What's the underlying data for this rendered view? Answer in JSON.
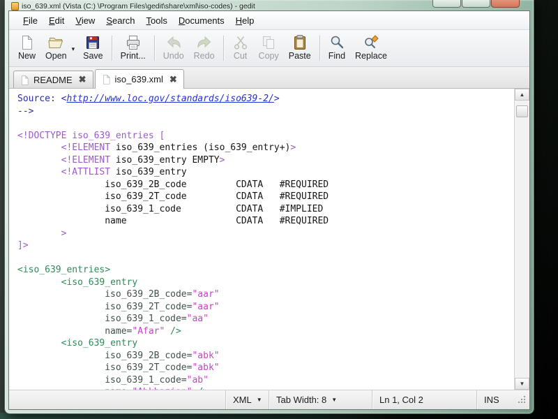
{
  "window": {
    "title": "iso_639.xml (Vista (C:) \\Program Files\\gedit\\share\\xml\\iso-codes) - gedit",
    "controls": [
      "minimize",
      "maximize",
      "close"
    ]
  },
  "menu_bar": {
    "items": [
      {
        "label": "File"
      },
      {
        "label": "Edit"
      },
      {
        "label": "View"
      },
      {
        "label": "Search"
      },
      {
        "label": "Tools"
      },
      {
        "label": "Documents"
      },
      {
        "label": "Help"
      }
    ]
  },
  "toolbar": {
    "items": [
      {
        "label": "New",
        "icon": "new-document-icon",
        "enabled": true
      },
      {
        "label": "Open",
        "icon": "open-folder-icon",
        "enabled": true,
        "caret": true
      },
      {
        "label": "Save",
        "icon": "save-icon",
        "enabled": true
      },
      {
        "type": "separator"
      },
      {
        "label": "Print...",
        "icon": "print-icon",
        "enabled": true
      },
      {
        "type": "separator"
      },
      {
        "label": "Undo",
        "icon": "undo-icon",
        "enabled": false
      },
      {
        "label": "Redo",
        "icon": "redo-icon",
        "enabled": false
      },
      {
        "type": "separator"
      },
      {
        "label": "Cut",
        "icon": "cut-icon",
        "enabled": false
      },
      {
        "label": "Copy",
        "icon": "copy-icon",
        "enabled": false
      },
      {
        "label": "Paste",
        "icon": "paste-icon",
        "enabled": true
      },
      {
        "type": "separator"
      },
      {
        "label": "Find",
        "icon": "find-icon",
        "enabled": true
      },
      {
        "label": "Replace",
        "icon": "replace-icon",
        "enabled": true
      }
    ]
  },
  "tab_bar": {
    "tabs": [
      {
        "title": "README",
        "active": false
      },
      {
        "title": "iso_639.xml",
        "active": true
      }
    ]
  },
  "editor": {
    "lines": [
      {
        "segs": [
          [
            "c",
            "Source: <"
          ],
          [
            "l",
            "http://www.loc.gov/standards/iso639-2/"
          ],
          [
            "c",
            ">"
          ]
        ]
      },
      {
        "segs": [
          [
            "c",
            "-->"
          ]
        ]
      },
      {
        "segs": []
      },
      {
        "segs": [
          [
            "k",
            "<!DOCTYPE iso_639_entries ["
          ]
        ]
      },
      {
        "segs": [
          [
            "p",
            "\t"
          ],
          [
            "k",
            "<!ELEMENT"
          ],
          [
            "p",
            " iso_639_entries (iso_639_entry+)"
          ],
          [
            "k",
            ">"
          ]
        ]
      },
      {
        "segs": [
          [
            "p",
            "\t"
          ],
          [
            "k",
            "<!ELEMENT"
          ],
          [
            "p",
            " iso_639_entry EMPTY"
          ],
          [
            "k",
            ">"
          ]
        ]
      },
      {
        "segs": [
          [
            "p",
            "\t"
          ],
          [
            "k",
            "<!ATTLIST"
          ],
          [
            "p",
            " iso_639_entry"
          ]
        ]
      },
      {
        "segs": [
          [
            "p",
            "\t\tiso_639_2B_code\t\tCDATA\t#REQUIRED"
          ]
        ]
      },
      {
        "segs": [
          [
            "p",
            "\t\tiso_639_2T_code\t\tCDATA\t#REQUIRED"
          ]
        ]
      },
      {
        "segs": [
          [
            "p",
            "\t\tiso_639_1_code\t\tCDATA\t#IMPLIED"
          ]
        ]
      },
      {
        "segs": [
          [
            "p",
            "\t\tname\t\t\tCDATA\t#REQUIRED"
          ]
        ]
      },
      {
        "segs": [
          [
            "p",
            "\t"
          ],
          [
            "k",
            ">"
          ]
        ]
      },
      {
        "segs": [
          [
            "k",
            "]>"
          ]
        ]
      },
      {
        "segs": []
      },
      {
        "segs": [
          [
            "e",
            "<iso_639_entries>"
          ]
        ]
      },
      {
        "segs": [
          [
            "p",
            "\t"
          ],
          [
            "e",
            "<iso_639_entry"
          ]
        ]
      },
      {
        "segs": [
          [
            "p",
            "\t\t"
          ],
          [
            "a",
            "iso_639_2B_code="
          ],
          [
            "v",
            "\"aar\""
          ]
        ]
      },
      {
        "segs": [
          [
            "p",
            "\t\t"
          ],
          [
            "a",
            "iso_639_2T_code="
          ],
          [
            "v",
            "\"aar\""
          ]
        ]
      },
      {
        "segs": [
          [
            "p",
            "\t\t"
          ],
          [
            "a",
            "iso_639_1_code="
          ],
          [
            "v",
            "\"aa\""
          ]
        ]
      },
      {
        "segs": [
          [
            "p",
            "\t\t"
          ],
          [
            "a",
            "name="
          ],
          [
            "v",
            "\"Afar\""
          ],
          [
            "e",
            " />"
          ]
        ]
      },
      {
        "segs": [
          [
            "p",
            "\t"
          ],
          [
            "e",
            "<iso_639_entry"
          ]
        ]
      },
      {
        "segs": [
          [
            "p",
            "\t\t"
          ],
          [
            "a",
            "iso_639_2B_code="
          ],
          [
            "v",
            "\"abk\""
          ]
        ]
      },
      {
        "segs": [
          [
            "p",
            "\t\t"
          ],
          [
            "a",
            "iso_639_2T_code="
          ],
          [
            "v",
            "\"abk\""
          ]
        ]
      },
      {
        "segs": [
          [
            "p",
            "\t\t"
          ],
          [
            "a",
            "iso_639_1_code="
          ],
          [
            "v",
            "\"ab\""
          ]
        ]
      },
      {
        "segs": [
          [
            "p",
            "\t\t"
          ],
          [
            "a",
            "name="
          ],
          [
            "v",
            "\"Abkhazian\""
          ],
          [
            "e",
            " />"
          ]
        ]
      }
    ]
  },
  "status_bar": {
    "language": "XML",
    "tab_width": "Tab Width: 8",
    "cursor_position": "Ln 1, Col 2",
    "overwrite_mode": "INS"
  },
  "icons": {
    "caret_down_small": "▾",
    "caret_down_status": "▼",
    "scroll_up": "▲",
    "scroll_down": "▼",
    "tab_close": "✖"
  },
  "colors": {
    "syntax": {
      "comment": "#2b2ba6",
      "link": "#2431d6",
      "keyword": "#9c59c9",
      "plain": "#141414",
      "element": "#2e8b57",
      "attribute": "#40514a",
      "value": "#cc3fcc"
    },
    "chrome": {
      "close_button": "#d4765a",
      "frame_glass": "#a9c9b6"
    }
  }
}
